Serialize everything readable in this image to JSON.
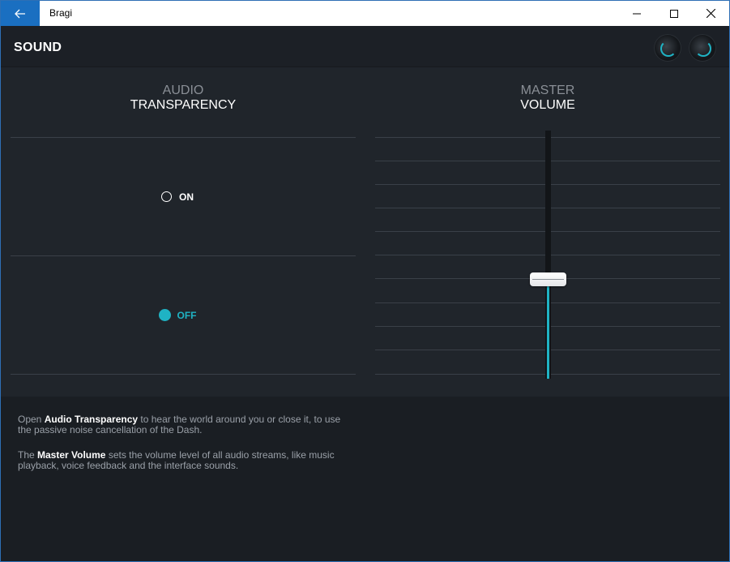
{
  "window": {
    "title": "Bragi"
  },
  "header": {
    "title": "SOUND",
    "accent_color": "#1fb3c4"
  },
  "audio_transparency": {
    "title_line1": "AUDIO",
    "title_line2": "TRANSPARENCY",
    "options": [
      {
        "label": "ON",
        "selected": false
      },
      {
        "label": "OFF",
        "selected": true
      }
    ]
  },
  "master_volume": {
    "title_line1": "MASTER",
    "title_line2": "VOLUME",
    "level_fraction": 0.4
  },
  "description": {
    "p1_pre": "Open ",
    "p1_bold": "Audio Transparency",
    "p1_post": " to hear the world around you or close it, to use the passive noise cancellation of the Dash.",
    "p2_pre": "The ",
    "p2_bold": "Master Volume",
    "p2_post": " sets the volume level of all audio streams, like music playback, voice feedback and the interface sounds."
  }
}
